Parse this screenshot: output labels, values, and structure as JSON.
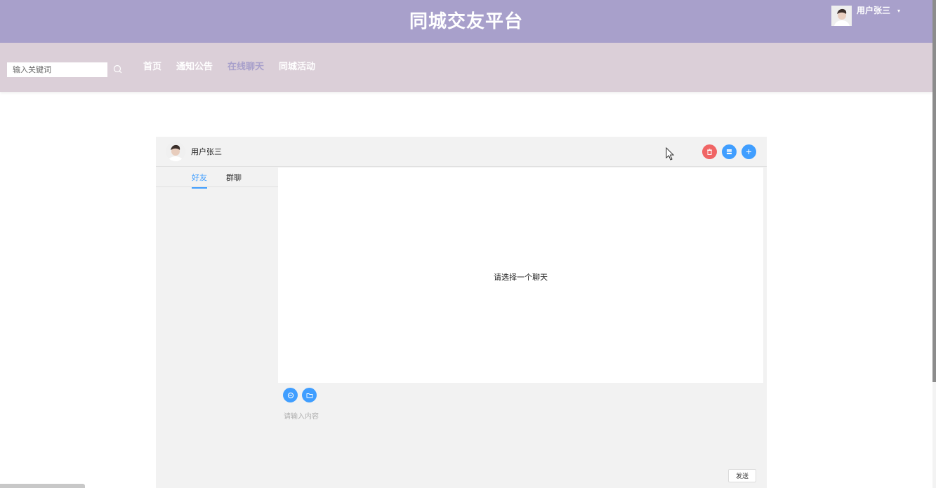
{
  "header": {
    "site_title": "同城交友平台",
    "user_name": "用户张三",
    "caret": "▾"
  },
  "nav": {
    "search_placeholder": "输入关键词",
    "links": [
      "首页",
      "通知公告",
      "在线聊天",
      "同城活动"
    ],
    "active_index": 2
  },
  "chat": {
    "user_name": "用户张三",
    "tabs": [
      "好友",
      "群聊"
    ],
    "empty_hint": "请选择一个聊天",
    "input_placeholder": "请输入内容",
    "send_label": "发送"
  },
  "colors": {
    "header_bg": "#a8a0cb",
    "nav_bg": "#dbcfd8",
    "accent": "#409eff",
    "danger": "#f06565"
  }
}
